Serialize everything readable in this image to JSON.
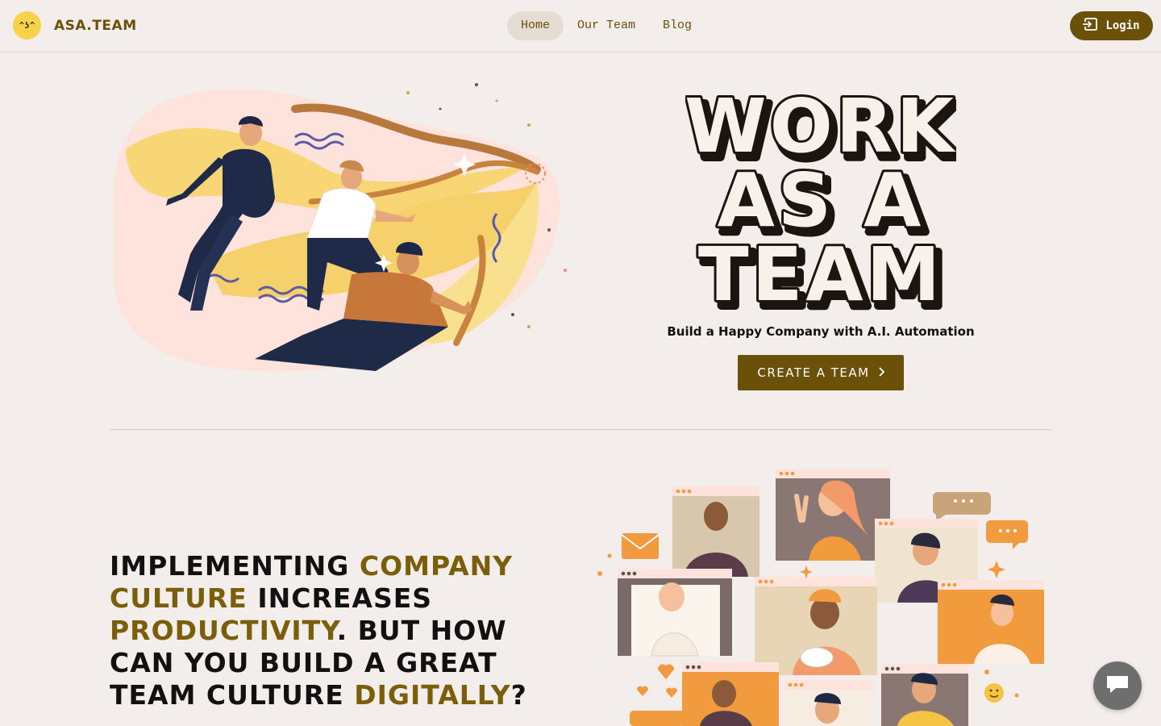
{
  "brand": {
    "logo_face": "^ʖ^",
    "name": "ASA.TEAM"
  },
  "nav": {
    "items": [
      {
        "label": "Home",
        "active": true
      },
      {
        "label": "Our Team",
        "active": false
      },
      {
        "label": "Blog",
        "active": false
      }
    ],
    "login_label": "Login",
    "login_icon": "login-arrow-icon"
  },
  "hero": {
    "title_lines": [
      "WORK",
      "AS A",
      "TEAM"
    ],
    "tagline": "Build a Happy Company with A.I. Automation",
    "cta_label": "CREATE A TEAM",
    "cta_icon": "chevron-right-icon"
  },
  "culture": {
    "parts": [
      {
        "text": "Implementing ",
        "highlight": false
      },
      {
        "text": "company culture",
        "highlight": true
      },
      {
        "text": " increases ",
        "highlight": false
      },
      {
        "text": "productivity",
        "highlight": true
      },
      {
        "text": ". But how can you build a great team culture ",
        "highlight": false
      },
      {
        "text": "digitally",
        "highlight": true
      },
      {
        "text": "?",
        "highlight": false
      }
    ]
  },
  "colors": {
    "brand": "#6b5009",
    "highlight": "#7a5e0a",
    "background": "#f3eeeb",
    "nav_active": "#e5dcd4",
    "chat_fab": "#6e6e6e"
  },
  "chat": {
    "icon": "chat-bubble-icon"
  }
}
